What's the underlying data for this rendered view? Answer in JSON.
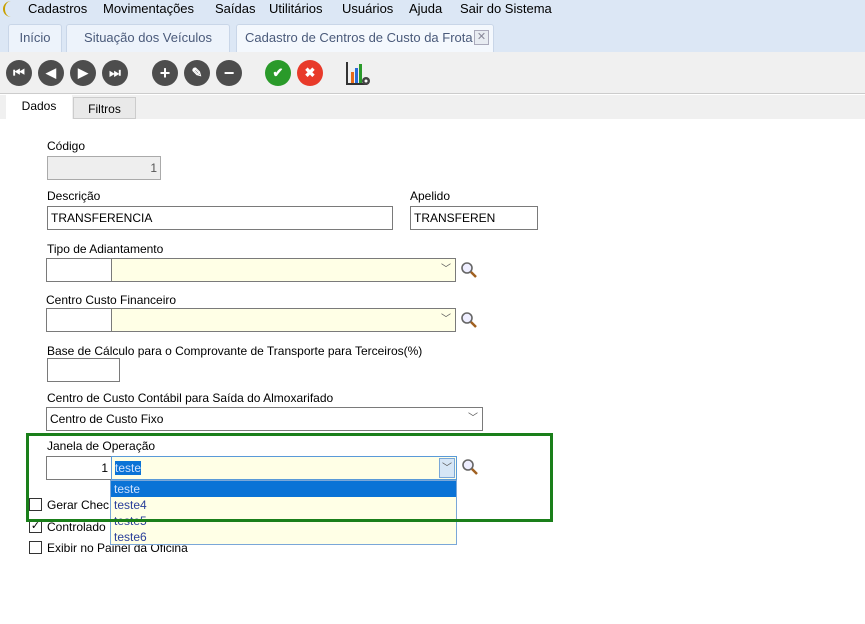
{
  "menu": [
    "Cadastros",
    "Movimentações",
    "Saídas",
    "Utilitários",
    "Usuários",
    "Ajuda",
    "Sair do Sistema"
  ],
  "tabs": [
    {
      "label": "Início"
    },
    {
      "label": "Situação dos Veículos"
    },
    {
      "label": "Cadastro de Centros de Custo da Frota",
      "active": true
    }
  ],
  "toolbar": {
    "icons": [
      "first-icon",
      "previous-icon",
      "next-icon",
      "last-icon",
      "add-icon",
      "edit-icon",
      "remove-icon",
      "confirm-icon",
      "cancel-icon",
      "report-chart-icon"
    ]
  },
  "subtabs": [
    "Dados",
    "Filtros"
  ],
  "form": {
    "codigo_label": "Código",
    "codigo_value": "1",
    "descricao_label": "Descrição",
    "descricao_value": "TRANSFERENCIA",
    "apelido_label": "Apelido",
    "apelido_value": "TRANSFEREN",
    "tipo_label": "Tipo de Adiantamento",
    "ccf_label": "Centro Custo Financeiro",
    "base_label": "Base de Cálculo para o Comprovante de  Transporte para Terceiros(%)",
    "ccc_label": "Centro de Custo Contábil para Saída do Almoxarifado",
    "ccc_value": "Centro de Custo Fixo",
    "janela_label": "Janela de Operação",
    "janela_code": "1",
    "janela_value": "teste",
    "janela_options": [
      "teste",
      "teste4",
      "teste5",
      "teste6"
    ],
    "cb_gerar": "Gerar Chec",
    "cb_controlado": "Controlado",
    "cb_exibir": "Exibir no Painel da Oficina",
    "cb_states": {
      "gerar": false,
      "controlado": true,
      "exibir": false
    }
  },
  "colors": {
    "highlight_border": "#1a7f1a",
    "selection": "#0a73d6",
    "field_yellow": "#ffffe6"
  }
}
